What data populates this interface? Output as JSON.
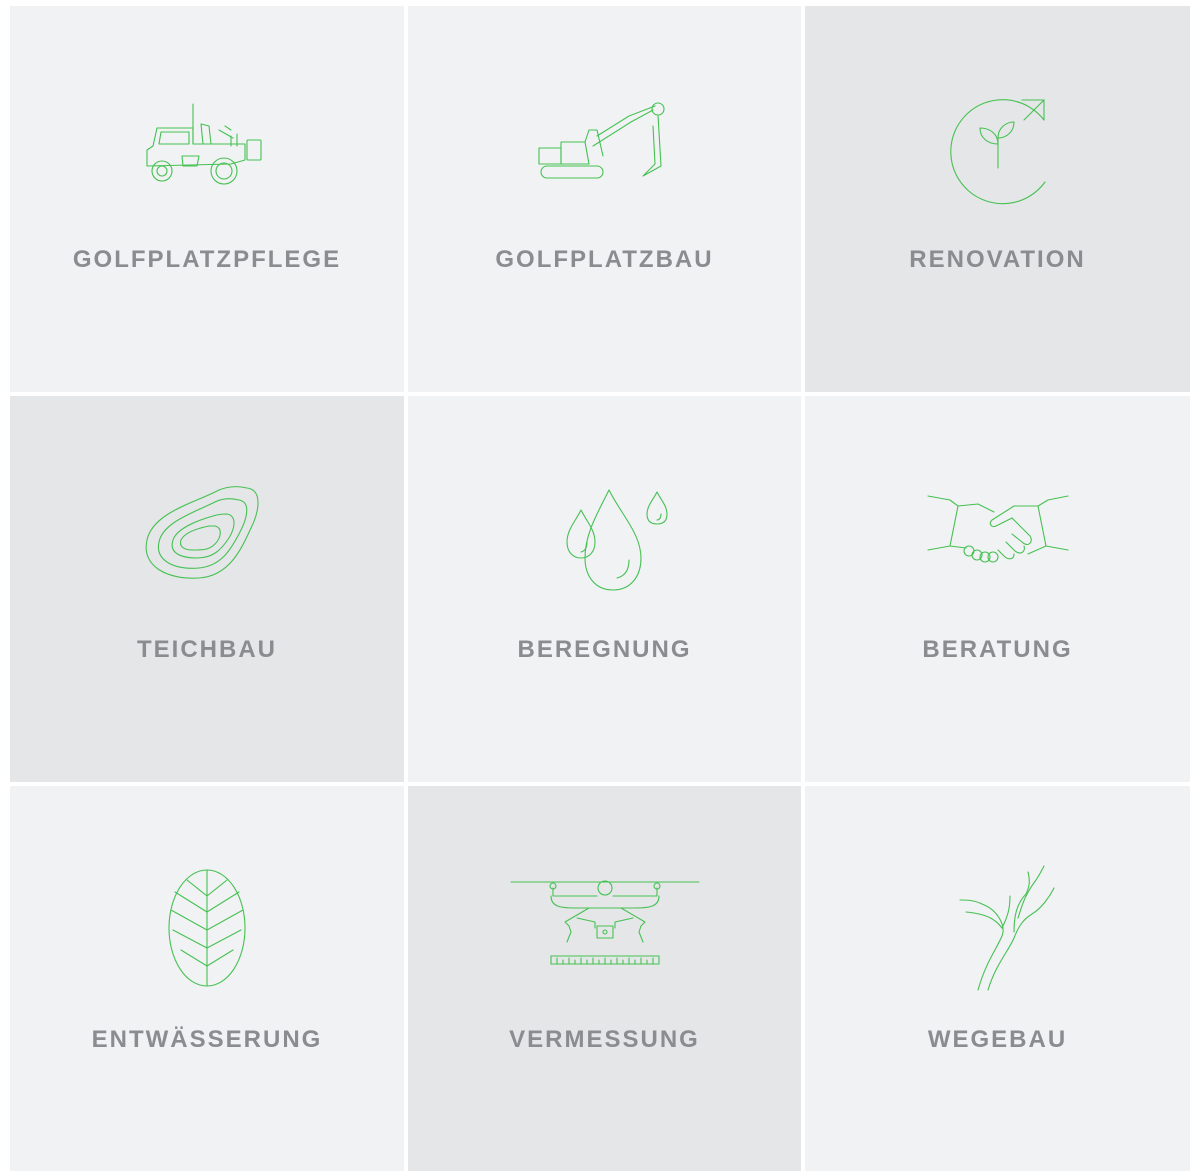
{
  "colors": {
    "tile_bg": "#f1f2f4",
    "tile_bg_alt": "#e5e6e8",
    "icon_stroke": "#45c152",
    "label_text": "#8b8c8f"
  },
  "tiles": [
    {
      "label": "GOLFPLATZPFLEGE",
      "icon": "mower-tractor-icon",
      "highlighted": false
    },
    {
      "label": "GOLFPLATZBAU",
      "icon": "excavator-icon",
      "highlighted": false
    },
    {
      "label": "RENOVATION",
      "icon": "sprout-refresh-icon",
      "highlighted": true
    },
    {
      "label": "TEICHBAU",
      "icon": "contour-pond-icon",
      "highlighted": true
    },
    {
      "label": "BEREGNUNG",
      "icon": "water-drops-icon",
      "highlighted": false
    },
    {
      "label": "BERATUNG",
      "icon": "handshake-icon",
      "highlighted": false
    },
    {
      "label": "ENTWÄSSERUNG",
      "icon": "leaf-icon",
      "highlighted": false
    },
    {
      "label": "VERMESSUNG",
      "icon": "survey-drone-icon",
      "highlighted": true
    },
    {
      "label": "WEGEBAU",
      "icon": "branching-path-icon",
      "highlighted": false
    }
  ]
}
